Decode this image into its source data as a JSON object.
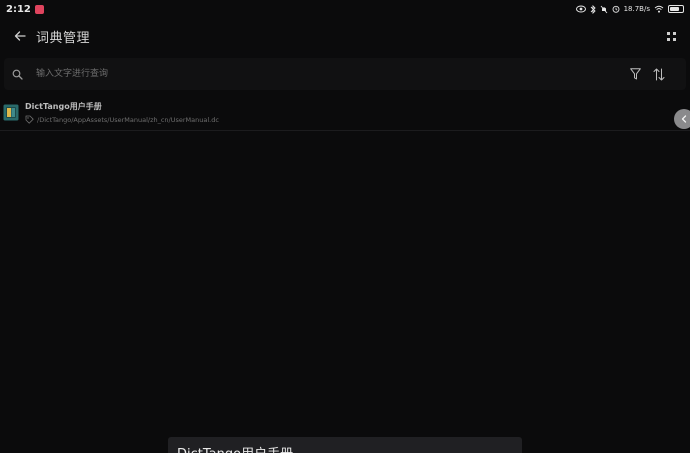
{
  "status_bar": {
    "time": "2:12",
    "network_speed": "18.7B/s",
    "battery_level": 0.8
  },
  "app_bar": {
    "title": "词典管理"
  },
  "search": {
    "placeholder": "输入文字进行查询"
  },
  "dictionaries": [
    {
      "name": "DictTango用户手册",
      "path": "/DictTango/AppAssets/UserManual/zh_cn/UserManual.dc"
    }
  ],
  "toast": {
    "text": "DictTango用户手册"
  },
  "colors": {
    "background": "#0b0b0c",
    "notification_badge": "#e0445e",
    "dict_icon_bg": "#2a6b6b",
    "dict_icon_accent": "#e0b84a"
  }
}
